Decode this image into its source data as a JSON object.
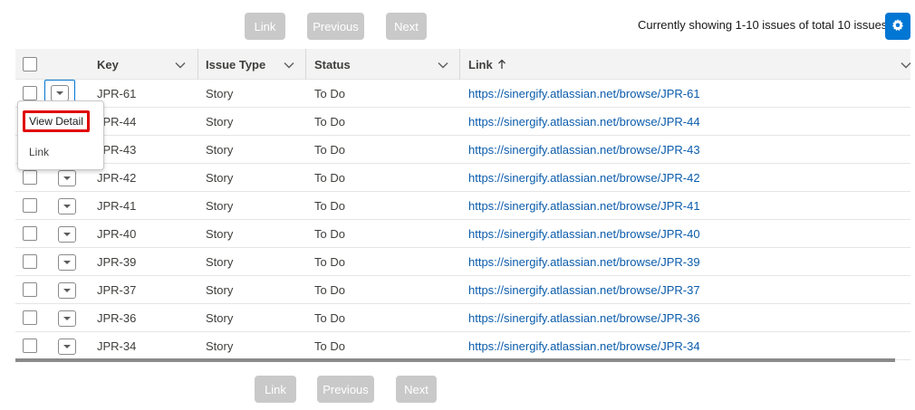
{
  "pager_top": {
    "link_label": "Link",
    "previous_label": "Previous",
    "next_label": "Next"
  },
  "pager_bottom": {
    "link_label": "Link",
    "previous_label": "Previous",
    "next_label": "Next"
  },
  "status_text": "Currently showing 1-10 issues of total 10 issues",
  "icons": {
    "settings": "gear-icon",
    "row_action": "chevron-down-icon",
    "sort": "arrow-up-icon"
  },
  "colors": {
    "accent": "#0176d3",
    "link": "#0b5cab",
    "highlight": "#e00000",
    "disabled_button": "#c9c9c9"
  },
  "table": {
    "columns": [
      {
        "label": "Key"
      },
      {
        "label": "Issue Type"
      },
      {
        "label": "Status"
      },
      {
        "label": "Link",
        "sort": "ascending"
      }
    ],
    "rows": [
      {
        "key": "JPR-61",
        "type": "Story",
        "status": "To Do",
        "link": "https://sinergify.atlassian.net/browse/JPR-61"
      },
      {
        "key": "JPR-44",
        "type": "Story",
        "status": "To Do",
        "link": "https://sinergify.atlassian.net/browse/JPR-44"
      },
      {
        "key": "JPR-43",
        "type": "Story",
        "status": "To Do",
        "link": "https://sinergify.atlassian.net/browse/JPR-43"
      },
      {
        "key": "JPR-42",
        "type": "Story",
        "status": "To Do",
        "link": "https://sinergify.atlassian.net/browse/JPR-42"
      },
      {
        "key": "JPR-41",
        "type": "Story",
        "status": "To Do",
        "link": "https://sinergify.atlassian.net/browse/JPR-41"
      },
      {
        "key": "JPR-40",
        "type": "Story",
        "status": "To Do",
        "link": "https://sinergify.atlassian.net/browse/JPR-40"
      },
      {
        "key": "JPR-39",
        "type": "Story",
        "status": "To Do",
        "link": "https://sinergify.atlassian.net/browse/JPR-39"
      },
      {
        "key": "JPR-37",
        "type": "Story",
        "status": "To Do",
        "link": "https://sinergify.atlassian.net/browse/JPR-37"
      },
      {
        "key": "JPR-36",
        "type": "Story",
        "status": "To Do",
        "link": "https://sinergify.atlassian.net/browse/JPR-36"
      },
      {
        "key": "JPR-34",
        "type": "Story",
        "status": "To Do",
        "link": "https://sinergify.atlassian.net/browse/JPR-34"
      }
    ]
  },
  "row_menu": {
    "view_detail_label": "View Detail",
    "link_label": "Link"
  }
}
